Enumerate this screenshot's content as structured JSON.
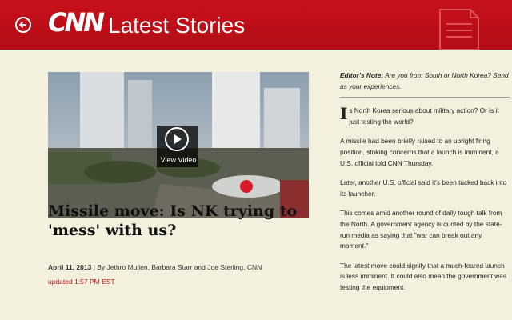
{
  "header": {
    "logo": "CNN",
    "title": "Latest Stories",
    "back_icon": "back-arrow-icon",
    "doc_icon": "document-icon",
    "color": "#c8101a"
  },
  "article": {
    "video_label": "View Video",
    "headline": "Missile move: Is NK trying to 'mess' with us?",
    "date": "April 11, 2013",
    "byline": "By Jethro Mullen, Barbara Starr and Joe Sterling, CNN",
    "updated": "updated 1:57 PM EST",
    "editors_note_label": "Editor's Note:",
    "editors_note": "Are you from South or North Korea? Send us your experiences.",
    "drop_cap": "I",
    "paragraphs": [
      "s North Korea serious about military action? Or is it just testing the world?",
      "A missile had been briefly raised to an upright firing position, stoking concerns that a launch is imminent, a U.S. official told CNN Thursday.",
      "Later, another U.S. official said it's been tucked back into its launcher.",
      "This comes amid another round of daily tough talk from the North. A government agency is quoted by the state-run media as saying that \"war can break out any moment.\"",
      "The latest move could signify that a much-feared launch is less imminent. It could also mean the government was testing the equipment."
    ]
  }
}
